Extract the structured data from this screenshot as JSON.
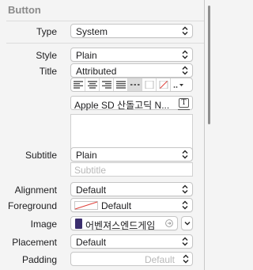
{
  "section": {
    "title": "Button"
  },
  "type": {
    "label": "Type",
    "value": "System"
  },
  "style": {
    "label": "Style",
    "value": "Plain"
  },
  "title": {
    "label": "Title",
    "value": "Attributed",
    "font": "Apple SD 산돌고딕 N..."
  },
  "subtitle": {
    "label": "Subtitle",
    "value": "Plain",
    "placeholder": "Subtitle"
  },
  "alignment": {
    "label": "Alignment",
    "value": "Default"
  },
  "foreground": {
    "label": "Foreground",
    "value": "Default"
  },
  "image": {
    "label": "Image",
    "value": "어벤져스엔드게임"
  },
  "placement": {
    "label": "Placement",
    "value": "Default"
  },
  "padding": {
    "label": "Padding",
    "placeholder": "Default"
  },
  "colors": {
    "swatch_slash": "#e0403a",
    "image_thumb": "#3b2e6e"
  }
}
